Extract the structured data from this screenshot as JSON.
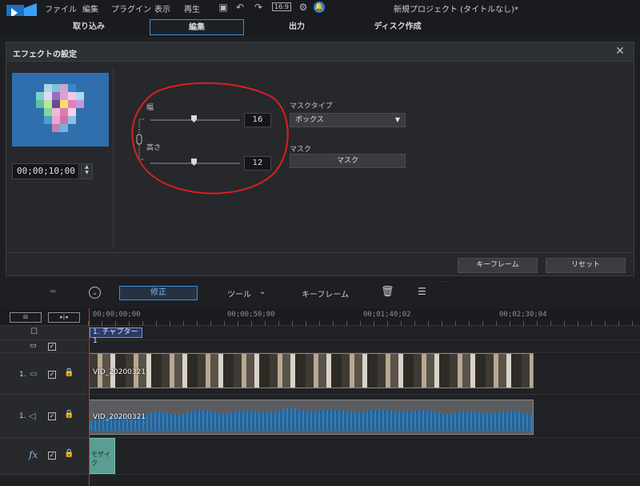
{
  "menubar": {
    "items": [
      "ファイル",
      "編集",
      "プラグイン",
      "表示",
      "再生"
    ],
    "aspect": "16:9",
    "window_title": "新規プロジェクト (タイトルなし)*"
  },
  "tabs": [
    {
      "label": "取り込み",
      "active": false
    },
    {
      "label": "編集",
      "active": true
    },
    {
      "label": "出力",
      "active": false
    },
    {
      "label": "ディスク作成",
      "active": false
    }
  ],
  "panel": {
    "title": "エフェクトの設定",
    "timecode": "00;00;10;00",
    "width_label": "幅",
    "width_value": "16",
    "height_label": "高さ",
    "height_value": "12",
    "mask_type_label": "マスクタイプ",
    "mask_type_value": "ボックス",
    "mask_label": "マスク",
    "mask_button": "マスク",
    "keyframe_button": "キーフレーム",
    "reset_button": "リセット"
  },
  "timeline_tools": {
    "mode": "修正",
    "tool": "ツール",
    "keyframe": "キーフレーム"
  },
  "timeline": {
    "ruler": [
      "00;00;00;00",
      "00;00;50;00",
      "00;01;40;02",
      "00;02;30;04"
    ],
    "chapter": "1. チャプター 1",
    "video_track_no": "1.",
    "audio_track_no": "1.",
    "video_clip": "VID_20200321",
    "audio_clip": "VID_20200321",
    "fx_label": "fx",
    "fx_clip": "モザイク"
  }
}
